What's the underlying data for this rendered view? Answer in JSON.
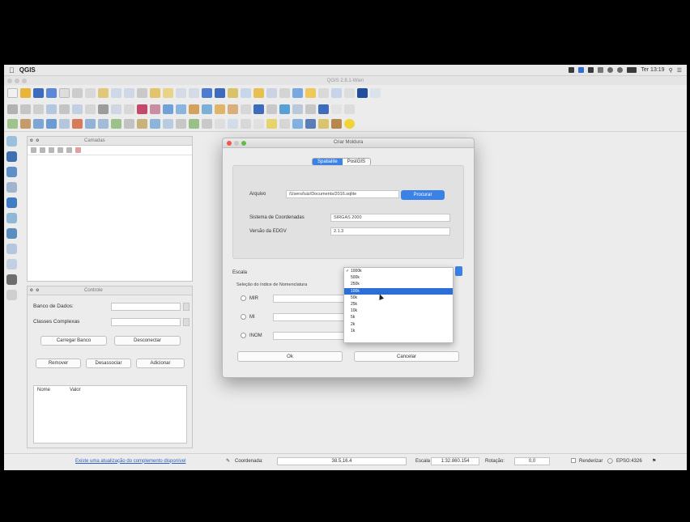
{
  "menubar": {
    "app_name": "QGIS",
    "time": "Ter 13:19"
  },
  "window": {
    "title": "QGIS 2.8.1-Wien"
  },
  "layers_panel": {
    "title": "Camadas"
  },
  "db_panel": {
    "title": "Controle",
    "banco_label": "Banco de Dados:",
    "classes_label": "Classes Complexas",
    "btn_carregar": "Carregar Banco",
    "btn_conectar": "Desconectar",
    "btn_remover": "Remover",
    "btn_desassociar": "Desassociar",
    "btn_adicionar": "Adicionar",
    "col_nome": "Nome",
    "col_valor": "Valor"
  },
  "dialog": {
    "title": "Criar Moldura",
    "tab_spatialite": "Spatialite",
    "tab_postgis": "PostGIS",
    "arquivo_label": "Arquivo",
    "arquivo_value": "/Users/luiz/Documents/2016.sqlite",
    "browse_label": "Procurar",
    "srs_label": "Sistema de Coordenadas",
    "srs_value": "SIRGAS 2000",
    "edgv_label": "Versão da EDGV",
    "edgv_value": "2.1.3",
    "escala_label": "Escala",
    "selecao_label": "Seleção do índice de Nomenclatura",
    "mir_label": "MIR",
    "mi_label": "MI",
    "inom_label": "INOM",
    "ok_label": "Ok",
    "cancel_label": "Cancelar"
  },
  "scale_options": [
    "1000k",
    "500k",
    "250k",
    "100k",
    "50k",
    "25k",
    "10k",
    "5k",
    "2k",
    "1k"
  ],
  "scale_selected_index": 3,
  "scale_checked_index": 0,
  "statusbar": {
    "link": "Existe uma atualização do complemento disponível",
    "coord_label": "Coordenada:",
    "coord_value": "38.5,16.4",
    "escala_label": "Escala",
    "escala_value": "1:32.860.154",
    "rotacao_label": "Rotação:",
    "rotacao_value": "0,0",
    "render_label": "Renderizar",
    "epsg_label": "EPSG:4326"
  },
  "colors": {
    "accent": "#3b82e6",
    "selection": "#2b6fd6"
  }
}
